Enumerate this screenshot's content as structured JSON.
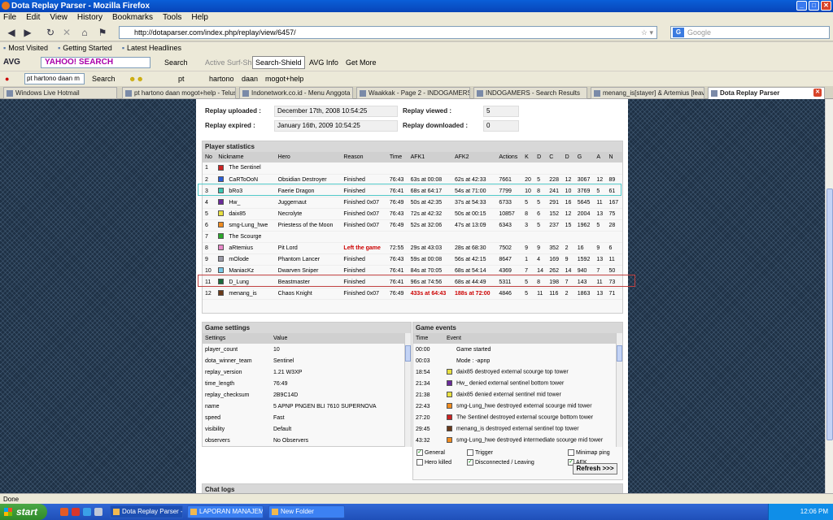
{
  "window": {
    "title": "Dota Replay Parser - Mozilla Firefox"
  },
  "menu": [
    "File",
    "Edit",
    "View",
    "History",
    "Bookmarks",
    "Tools",
    "Help"
  ],
  "nav": {
    "url": "http://dotaparser.com/index.php/replay/view/6457/",
    "search_placeholder": "Google"
  },
  "bookmarks": [
    "Most Visited",
    "Getting Started",
    "Latest Headlines"
  ],
  "avg": {
    "logo": "AVG",
    "yahoo": "YAHOO! SEARCH",
    "search": "Search",
    "surf_shield": "Active Surf-Shield",
    "search_shield": "Search-Shield",
    "avg_info": "AVG Info",
    "get_more": "Get More"
  },
  "toolbar3": {
    "query": "pt hartono daan m",
    "search": "Search",
    "items": [
      "pt",
      "hartono",
      "daan",
      "mogot+help"
    ]
  },
  "tabs": [
    "Windows Live Hotmail",
    "pt hartono daan mogot+help - Telus...",
    "Indonetwork.co.id - Menu Anggota ...",
    "Waakkak - Page 2 - INDOGAMERS",
    "INDOGAMERS - Search Results",
    "menang_is[stayer] & Artemius [leav...",
    "Dota Replay Parser"
  ],
  "replay_info": [
    {
      "label": "Replay uploaded :",
      "value": "December 17th, 2008 10:54:25",
      "label2": "Replay viewed :",
      "value2": "5"
    },
    {
      "label": "Replay expired :",
      "value": "January 16th, 2009 10:54:25",
      "label2": "Replay downloaded :",
      "value2": "0"
    }
  ],
  "players": {
    "title": "Player statistics",
    "headers": [
      "No",
      "Nickname",
      "Hero",
      "Reason",
      "Time",
      "AFK1",
      "AFK2",
      "Actions",
      "K",
      "D",
      "C",
      "D",
      "G",
      "A",
      "N"
    ],
    "rows": [
      {
        "no": "1",
        "color": "#cc2222",
        "nick": "The Sentinel",
        "hero": "",
        "reason": "",
        "time": "",
        "afk1": "",
        "afk2": "",
        "actions": "",
        "k": "",
        "d": "",
        "c": "",
        "d2": "",
        "g": "",
        "a": "",
        "n": ""
      },
      {
        "no": "2",
        "color": "#2a5fd8",
        "nick": "CaRToOoN",
        "hero": "Obsidian Destroyer",
        "reason": "Finished",
        "time": "76:43",
        "afk1": "63s at 00:08",
        "afk2": "62s at 42:33",
        "actions": "7661",
        "k": "20",
        "d": "5",
        "c": "228",
        "d2": "12",
        "g": "3067",
        "a": "12",
        "n": "89"
      },
      {
        "no": "3",
        "color": "#3cc8b4",
        "nick": "bRo3",
        "hero": "Faerie Dragon",
        "reason": "Finished",
        "time": "76:41",
        "afk1": "68s at 64:17",
        "afk2": "54s at 71:00",
        "actions": "7799",
        "k": "10",
        "d": "8",
        "c": "241",
        "d2": "10",
        "g": "3769",
        "a": "5",
        "n": "61"
      },
      {
        "no": "4",
        "color": "#6a2a9a",
        "nick": "Hw_",
        "hero": "Juggernaut",
        "reason": "Finished 0x07",
        "time": "76:49",
        "afk1": "50s at 42:35",
        "afk2": "37s at 54:33",
        "actions": "6733",
        "k": "5",
        "d": "5",
        "c": "291",
        "d2": "16",
        "g": "5645",
        "a": "11",
        "n": "167"
      },
      {
        "no": "5",
        "color": "#e8e040",
        "nick": "daix85",
        "hero": "Necrolyte",
        "reason": "Finished 0x07",
        "time": "76:43",
        "afk1": "72s at 42:32",
        "afk2": "50s at 00:15",
        "actions": "10857",
        "k": "8",
        "d": "6",
        "c": "152",
        "d2": "12",
        "g": "2004",
        "a": "13",
        "n": "75"
      },
      {
        "no": "6",
        "color": "#f08c20",
        "nick": "smg-Lung_hwe",
        "hero": "Priestess of the Moon",
        "reason": "Finished 0x07",
        "time": "76:49",
        "afk1": "52s at 32:06",
        "afk2": "47s at 13:09",
        "actions": "6343",
        "k": "3",
        "d": "5",
        "c": "237",
        "d2": "15",
        "g": "1962",
        "a": "5",
        "n": "28"
      },
      {
        "no": "7",
        "color": "#2aa82a",
        "nick": "The Scourge",
        "hero": "",
        "reason": "",
        "time": "",
        "afk1": "",
        "afk2": "",
        "actions": "",
        "k": "",
        "d": "",
        "c": "",
        "d2": "",
        "g": "",
        "a": "",
        "n": ""
      },
      {
        "no": "8",
        "color": "#e888c8",
        "nick": "aRtemius",
        "hero": "Pit Lord",
        "reason": "Left the game",
        "time": "72:55",
        "afk1": "29s at 43:03",
        "afk2": "28s at 68:30",
        "actions": "7502",
        "k": "9",
        "d": "9",
        "c": "352",
        "d2": "2",
        "g": "16",
        "a": "9",
        "n": "6"
      },
      {
        "no": "9",
        "color": "#9a9aa8",
        "nick": "mOlode",
        "hero": "Phantom Lancer",
        "reason": "Finished",
        "time": "76:43",
        "afk1": "59s at 00:08",
        "afk2": "56s at 42:15",
        "actions": "8647",
        "k": "1",
        "d": "4",
        "c": "169",
        "d2": "9",
        "g": "1592",
        "a": "13",
        "n": "11"
      },
      {
        "no": "10",
        "color": "#78c8e8",
        "nick": "ManiacKz",
        "hero": "Dwarven Sniper",
        "reason": "Finished",
        "time": "76:41",
        "afk1": "84s at 70:05",
        "afk2": "68s at 54:14",
        "actions": "4369",
        "k": "7",
        "d": "14",
        "c": "262",
        "d2": "14",
        "g": "940",
        "a": "7",
        "n": "50"
      },
      {
        "no": "11",
        "color": "#1a6a3a",
        "nick": "D_Lung",
        "hero": "Beastmaster",
        "reason": "Finished",
        "time": "76:41",
        "afk1": "96s at 74:56",
        "afk2": "68s at 44:49",
        "actions": "5311",
        "k": "5",
        "d": "8",
        "c": "198",
        "d2": "7",
        "g": "143",
        "a": "11",
        "n": "73"
      },
      {
        "no": "12",
        "color": "#6a3a1a",
        "nick": "menang_is",
        "hero": "Chaos Knight",
        "reason": "Finished 0x07",
        "time": "76:49",
        "afk1": "433s at 64:43",
        "afk2": "188s at 72:00",
        "actions": "4846",
        "k": "5",
        "d": "11",
        "c": "116",
        "d2": "2",
        "g": "1863",
        "a": "13",
        "n": "71"
      }
    ]
  },
  "settings": {
    "title": "Game settings",
    "headers": [
      "Settings",
      "Value"
    ],
    "rows": [
      {
        "k": "player_count",
        "v": "10"
      },
      {
        "k": "dota_winner_team",
        "v": "Sentinel"
      },
      {
        "k": "replay_version",
        "v": "1.21 W3XP"
      },
      {
        "k": "time_length",
        "v": "76:49"
      },
      {
        "k": "replay_checksum",
        "v": "2B9C14D"
      },
      {
        "k": "name",
        "v": "5 APNP PNGEN BLI 7610 SUPERNOVA"
      },
      {
        "k": "speed",
        "v": "Fast"
      },
      {
        "k": "visibility",
        "v": "Default"
      },
      {
        "k": "observers",
        "v": "No Observers"
      }
    ]
  },
  "events": {
    "title": "Game events",
    "headers": [
      "Time",
      "Event"
    ],
    "rows": [
      {
        "t": "00:00",
        "color": "",
        "e": "Game started"
      },
      {
        "t": "00:03",
        "color": "",
        "e": "Mode : -apnp"
      },
      {
        "t": "18:54",
        "color": "#e8e040",
        "e": "daix85 destroyed external scourge top tower"
      },
      {
        "t": "21:34",
        "color": "#6a2a9a",
        "e": "Hw_ denied external sentinel bottom tower"
      },
      {
        "t": "21:38",
        "color": "#e8e040",
        "e": "daix85 denied external sentinel mid tower"
      },
      {
        "t": "22:43",
        "color": "#f08c20",
        "e": "smg-Lung_hwe destroyed external scourge mid tower"
      },
      {
        "t": "27:20",
        "color": "#cc2222",
        "e": "The Sentinel destroyed external scourge bottom tower"
      },
      {
        "t": "29:45",
        "color": "#6a3a1a",
        "e": "menang_is destroyed external sentinel top tower"
      },
      {
        "t": "43:32",
        "color": "#f08c20",
        "e": "smg-Lung_hwe destroyed intermediate scourge mid tower"
      }
    ],
    "filters": [
      {
        "label": "General",
        "checked": "✓"
      },
      {
        "label": "Trigger",
        "checked": ""
      },
      {
        "label": "Minimap ping",
        "checked": ""
      },
      {
        "label": "Hero killed",
        "checked": ""
      },
      {
        "label": "Disconnected / Leaving",
        "checked": "✓"
      },
      {
        "label": "AFK",
        "checked": "✓"
      }
    ],
    "refresh": "Refresh >>>"
  },
  "chat_logs": "Chat logs",
  "status": "Done",
  "taskbar": {
    "start": "start",
    "items": [
      "Dota Replay Parser - ...",
      "LAPORAN MANAJEME...",
      "New Folder"
    ],
    "clock": "12:06 PM"
  }
}
